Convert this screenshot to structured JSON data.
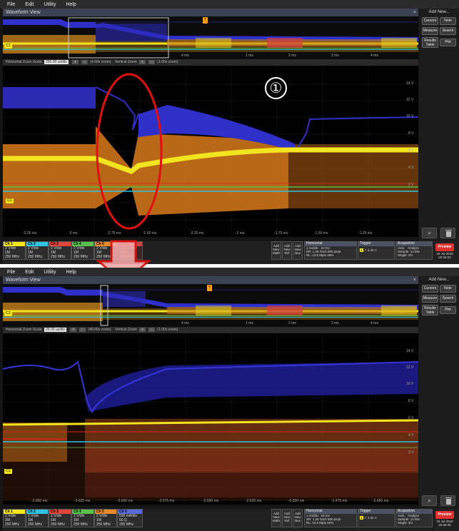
{
  "menu": [
    "File",
    "Edit",
    "Utility",
    "Help"
  ],
  "window_title": "Waveform View",
  "window_close": "×",
  "annotation_number": "①",
  "right_panel": {
    "add_new": "Add New...",
    "buttons": [
      "Cursors",
      "Note",
      "Measure",
      "Search"
    ],
    "results_table": [
      "Results",
      "Table"
    ],
    "plot": "Plot"
  },
  "channels": [
    {
      "label": "Ch 1",
      "line1": "2 V/div",
      "line2": "1M",
      "line3": "250 MHz",
      "color": "#f2e41f"
    },
    {
      "label": "Ch 2",
      "line1": "2 V/div",
      "line2": "1M",
      "line3": "250 MHz",
      "color": "#2fc3e0"
    },
    {
      "label": "Ch 3",
      "line1": "2 V/div",
      "line2": "1M",
      "line3": "250 MHz",
      "color": "#e0443a"
    },
    {
      "label": "Ch 4",
      "line1": "2 V/div",
      "line2": "1M",
      "line3": "250 MHz",
      "color": "#58c04b"
    },
    {
      "label": "Ch 5",
      "line1": "2 V/div",
      "line2": "1M",
      "line3": "250 MHz",
      "color": "#e78a2a"
    },
    {
      "label": "Ch 6",
      "line1": "500 mA/div",
      "line2": "50 Ω",
      "line3": "250 MHz",
      "color": "#5b6bd8"
    }
  ],
  "add_buttons": [
    [
      "Add",
      "New",
      "Math"
    ],
    [
      "Add",
      "New",
      "Ref"
    ],
    [
      "Add",
      "New",
      "Bus"
    ]
  ],
  "top": {
    "zoom_text": "Horizontal Zoom Scale",
    "zoom_value": "250.00 us/div",
    "zoom_x": "(4.00x zoom)",
    "vertical_zoom": "Vertical Zoom",
    "vzoom_x": "(1.00x zoom)",
    "horizontal": {
      "title": "Horizontal",
      "l1": "1 ms/div",
      "l1b": "10 ms",
      "l2": "SR: 1.25 GS/s",
      "l2b": "800 ps/pt",
      "l3": "RL: 12.5 Mpts",
      "l3b": "49%"
    },
    "trigger": {
      "title": "Trigger",
      "ch": "1",
      "level": "2.32 V"
    },
    "acquisition": {
      "title": "Acquisition",
      "l1": "Auto,",
      "l1b": "Analyze",
      "l2": "Sample: 12 bits",
      "l3": "Single: 0/1"
    },
    "preview": "Preview",
    "date": "19 Jul 2018",
    "time": "20:34:22",
    "y_labels": [
      "14 V",
      "12 V",
      "10 V",
      "8 V",
      "6 V",
      "4 V",
      "2 V"
    ],
    "x_labels": [
      "-3.25 ms",
      "-3 ms",
      "-2.75 ms",
      "-2.50 ms",
      "-2.25 ms",
      "-2 ms",
      "-1.75 ms",
      "-1.50 ms",
      "-1.25 ms"
    ],
    "overview_x": [
      "4 ms",
      "1 ms",
      "2 ms",
      "3 ms",
      "4 ms"
    ]
  },
  "bottom": {
    "zoom_text": "Horizontal Zoom Scale",
    "zoom_value": "25.00 us/div",
    "zoom_x": "(40.00x zoom)",
    "vertical_zoom": "Vertical Zoom",
    "vzoom_x": "(1.00x zoom)",
    "horizontal": {
      "title": "Horizontal",
      "l1": "1 ms/div",
      "l1b": "10 ms",
      "l2": "SR: 1.25 GS/s",
      "l2b": "800 ps/pt",
      "l3": "RL: 12.5 Mpts",
      "l3b": "50%"
    },
    "trigger": {
      "title": "Trigger",
      "ch": "1",
      "level": "2.32 V"
    },
    "acquisition": {
      "title": "Acquisition",
      "l1": "Auto,",
      "l1b": "Analyze",
      "l2": "Sample: 12 bits",
      "l3": "Single: 0/1"
    },
    "preview": "Preview",
    "date": "19 Jul 2018",
    "time": "20:36:35",
    "y_labels": [
      "14 V",
      "12 V",
      "10 V",
      "8 V",
      "6 V",
      "4 V",
      "2 V"
    ],
    "x_labels": [
      "-2.650 ms",
      "-2.625 ms",
      "-2.600 ms",
      "-2.575 ms",
      "-2.550 ms",
      "-2.525 ms",
      "-2.500 ms",
      "-2.475 ms",
      "-2.450 ms"
    ],
    "overview_x": [
      "4 ms",
      "1 ms",
      "2 ms",
      "3 ms",
      "4 ms"
    ]
  },
  "colors": {
    "yellow": "#f2e41f",
    "blue": "#2f2fc9",
    "orange": "#e8801e",
    "red": "#e02020",
    "cyan": "#2fc3e0",
    "green": "#58c04b",
    "preview": "#e03030"
  }
}
